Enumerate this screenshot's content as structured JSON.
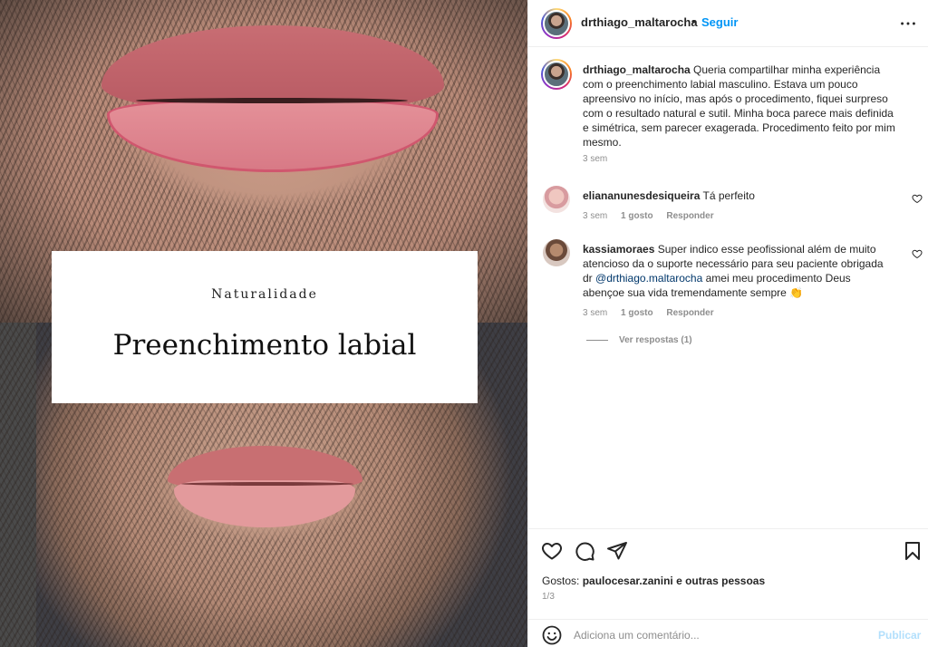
{
  "image_overlay": {
    "kicker": "Naturalidade",
    "title": "Preenchimento labial"
  },
  "header": {
    "username": "drthiago_maltarocha",
    "dot": "•",
    "follow_label": "Seguir",
    "more_icon": "more-horizontal-icon"
  },
  "caption": {
    "username": "drthiago_maltarocha",
    "text": "Queria compartilhar minha experiência com o preenchimento labial masculino. Estava um pouco apreensivo no início, mas após o procedimento, fiquei surpreso com o resultado natural e sutil. Minha boca parece mais definida e simétrica, sem parecer exagerada. Procedimento feito por mim mesmo.",
    "time": "3 sem"
  },
  "comments": [
    {
      "username": "eliananunesdesiqueira",
      "text": "Tá perfeito",
      "time": "3 sem",
      "likes": "1 gosto",
      "reply_label": "Responder"
    },
    {
      "username": "kassiamoraes",
      "text_before": "Super indico esse peofissional além de muito atencioso da o suporte necessário para seu paciente obrigada dr ",
      "mention": "@drthiago.maltarocha",
      "text_after": " amei meu procedimento Deus abençoe sua vida tremendamente sempre 👏",
      "time": "3 sem",
      "likes": "1 gosto",
      "reply_label": "Responder",
      "view_replies": "Ver respostas (1)"
    }
  ],
  "likes": {
    "prefix": "Gostos:",
    "user": "paulocesar.zanini",
    "suffix": "e outras pessoas"
  },
  "counter": "1/3",
  "add_comment": {
    "placeholder": "Adiciona um comentário...",
    "publish_label": "Publicar"
  },
  "colors": {
    "follow": "#0095f6",
    "publish_disabled": "#b2dffc",
    "muted": "#8e8e8e",
    "mention": "#00376b"
  }
}
